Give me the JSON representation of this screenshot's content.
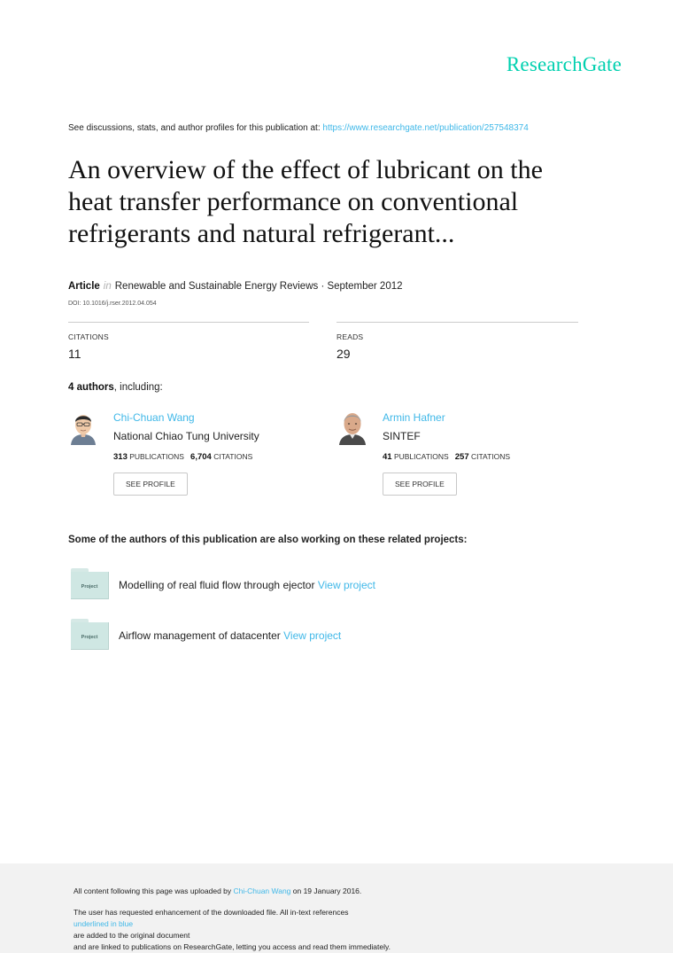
{
  "brand": "ResearchGate",
  "intro": {
    "text": "See discussions, stats, and author profiles for this publication at: ",
    "url": "https://www.researchgate.net/publication/257548374"
  },
  "title_lines": [
    "An overview of the effect of lubricant on the",
    "heat transfer performance on conventional",
    "refrigerants and natural refrigerant..."
  ],
  "meta": {
    "type": "Article",
    "in": "in",
    "journal": "Renewable and Sustainable Energy Reviews · September 2012",
    "doi": "DOI: 10.1016/j.rser.2012.04.054"
  },
  "stats": {
    "citations_label": "CITATIONS",
    "citations_value": "11",
    "reads_label": "READS",
    "reads_value": "29"
  },
  "authors_heading": {
    "count": "4 authors",
    "suffix": ", including:"
  },
  "authors": [
    {
      "name": "Chi-Chuan Wang",
      "institution": "National Chiao Tung University",
      "publications": "313",
      "publications_label": "PUBLICATIONS",
      "citations": "6,704",
      "citations_label": "CITATIONS",
      "button": "SEE PROFILE"
    },
    {
      "name": "Armin Hafner",
      "institution": "SINTEF",
      "publications": "41",
      "publications_label": "PUBLICATIONS",
      "citations": "257",
      "citations_label": "CITATIONS",
      "button": "SEE PROFILE"
    }
  ],
  "projects_heading": "Some of the authors of this publication are also working on these related projects:",
  "projects": [
    {
      "icon_label": "Project",
      "text": "Modelling of real fluid flow through ejector",
      "link": "View project"
    },
    {
      "icon_label": "Project",
      "text": "Airflow management of datacenter",
      "link": "View project"
    }
  ],
  "footer": {
    "upload_prefix": "All content following this page was uploaded by ",
    "uploader": "Chi-Chuan Wang",
    "upload_suffix": " on 19 January 2016.",
    "notice_prefix": "The user has requested enhancement of the downloaded file. All in-text references ",
    "notice_link": "underlined in blue",
    "notice_suffix": " are added to the original document",
    "notice_line2": "and are linked to publications on ResearchGate, letting you access and read them immediately."
  },
  "colors": {
    "brand": "#00d0af",
    "link": "#40b8e8",
    "footer_bg": "#f2f2f2",
    "folder": "#cfe7e3"
  }
}
